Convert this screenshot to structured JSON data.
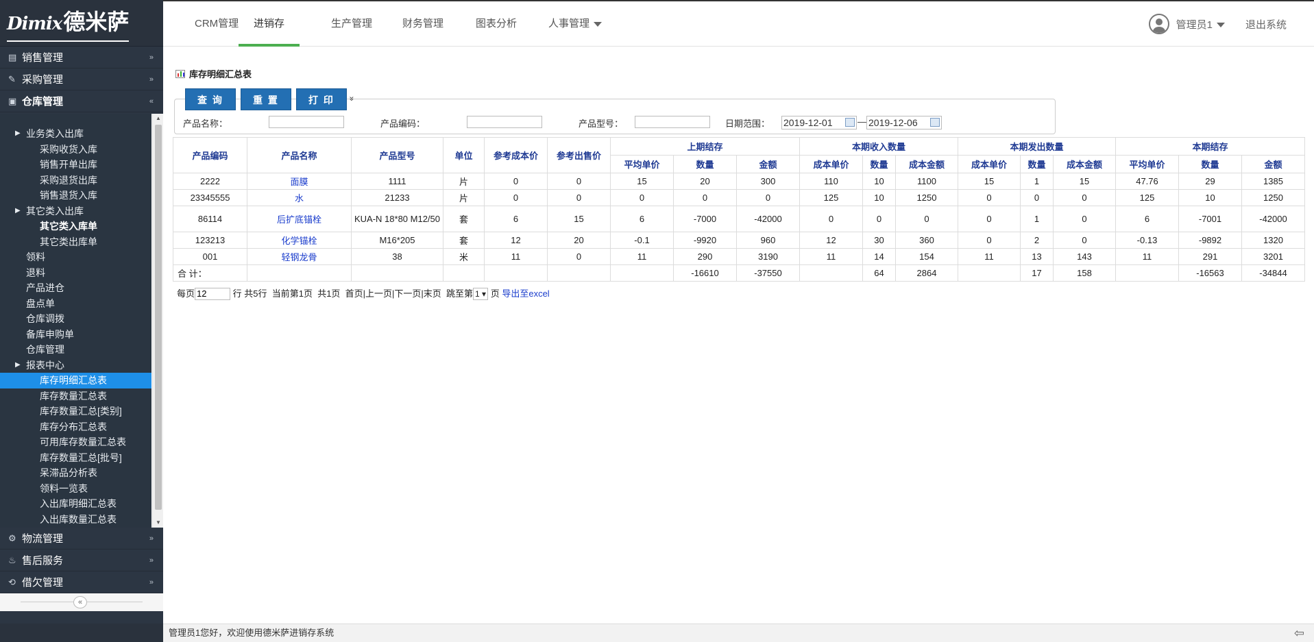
{
  "logo": {
    "en": "Dimix",
    "zh": "德米萨"
  },
  "sidebar": {
    "top_menus": [
      {
        "label": "销售管理",
        "icon": "list-icon",
        "chev": "»"
      },
      {
        "label": "采购管理",
        "icon": "edit-icon",
        "chev": "»"
      },
      {
        "label": "仓库管理",
        "icon": "warehouse-icon",
        "chev": "«"
      }
    ],
    "sub_items": [
      {
        "label": "业务类入出库",
        "level": 1,
        "tri": true
      },
      {
        "label": "采购收货入库",
        "level": 2
      },
      {
        "label": "销售开单出库",
        "level": 2
      },
      {
        "label": "采购退货出库",
        "level": 2
      },
      {
        "label": "销售退货入库",
        "level": 2
      },
      {
        "label": "其它类入出库",
        "level": 1,
        "tri": true
      },
      {
        "label": "其它类入库单",
        "level": 2,
        "bold": true
      },
      {
        "label": "其它类出库单",
        "level": 2
      },
      {
        "label": "领料",
        "level": 1
      },
      {
        "label": "退料",
        "level": 1
      },
      {
        "label": "产品进仓",
        "level": 1
      },
      {
        "label": "盘点单",
        "level": 1
      },
      {
        "label": "仓库调拨",
        "level": 1
      },
      {
        "label": "备库申购单",
        "level": 1
      },
      {
        "label": "仓库管理",
        "level": 1
      },
      {
        "label": "报表中心",
        "level": 1,
        "tri": true
      },
      {
        "label": "库存明细汇总表",
        "level": 2,
        "active": true
      },
      {
        "label": "库存数量汇总表",
        "level": 2
      },
      {
        "label": "库存数量汇总[类别]",
        "level": 2
      },
      {
        "label": "库存分布汇总表",
        "level": 2
      },
      {
        "label": "可用库存数量汇总表",
        "level": 2
      },
      {
        "label": "库存数量汇总[批号]",
        "level": 2
      },
      {
        "label": "呆滞品分析表",
        "level": 2
      },
      {
        "label": "领料一览表",
        "level": 2
      },
      {
        "label": "入出库明细汇总表",
        "level": 2
      },
      {
        "label": "入出库数量汇总表",
        "level": 2
      }
    ],
    "bottom_menus": [
      {
        "label": "物流管理",
        "icon": "logistics-icon",
        "chev": "»"
      },
      {
        "label": "售后服务",
        "icon": "service-icon",
        "chev": "»"
      },
      {
        "label": "借欠管理",
        "icon": "loan-icon",
        "chev": "»"
      }
    ],
    "collapse_glyph": "«"
  },
  "topnav": {
    "items": [
      "CRM管理",
      "进销存",
      "生产管理",
      "财务管理",
      "图表分析",
      "人事管理"
    ],
    "active_index": 1,
    "user": "管理员1",
    "logout": "退出系统"
  },
  "page": {
    "title": "库存明细汇总表",
    "buttons": {
      "query": "查 询",
      "reset": "重 置",
      "print": "打 印"
    },
    "expand_glyph": "»",
    "filters": {
      "product_name_label": "产品名称：",
      "product_code_label": "产品编码：",
      "product_model_label": "产品型号：",
      "date_range_label": "日期范围：",
      "date_from": "2019-12-01",
      "date_sep": "—",
      "date_to": "2019-12-06"
    }
  },
  "table": {
    "group_headers": [
      "上期结存",
      "本期收入数量",
      "本期发出数量",
      "本期结存"
    ],
    "fixed_headers": [
      "产品编码",
      "产品名称",
      "产品型号",
      "单位",
      "参考成本价",
      "参考出售价"
    ],
    "sub_headers": [
      "平均单价",
      "数量",
      "金额",
      "成本单价",
      "数量",
      "成本金额",
      "成本单价",
      "数量",
      "成本金额",
      "平均单价",
      "数量",
      "金额"
    ],
    "rows": [
      [
        "2222",
        "面膜",
        "1111",
        "片",
        "0",
        "0",
        "15",
        "20",
        "300",
        "110",
        "10",
        "1100",
        "15",
        "1",
        "15",
        "47.76",
        "29",
        "1385"
      ],
      [
        "23345555",
        "水",
        "21233",
        "片",
        "0",
        "0",
        "0",
        "0",
        "0",
        "125",
        "10",
        "1250",
        "0",
        "0",
        "0",
        "125",
        "10",
        "1250"
      ],
      [
        "86114",
        "后扩底锚栓",
        "KUA-N 18*80 M12/50",
        "套",
        "6",
        "15",
        "6",
        "-7000",
        "-42000",
        "0",
        "0",
        "0",
        "0",
        "1",
        "0",
        "6",
        "-7001",
        "-42000"
      ],
      [
        "123213",
        "化学锚栓",
        "M16*205",
        "套",
        "12",
        "20",
        "-0.1",
        "-9920",
        "960",
        "12",
        "30",
        "360",
        "0",
        "2",
        "0",
        "-0.13",
        "-9892",
        "1320"
      ],
      [
        "001",
        "轻钢龙骨",
        "38",
        "米",
        "11",
        "0",
        "11",
        "290",
        "3190",
        "11",
        "14",
        "154",
        "11",
        "13",
        "143",
        "11",
        "291",
        "3201"
      ]
    ],
    "total": [
      "合 计：",
      "",
      "",
      "",
      "",
      "",
      "",
      "-16610",
      "-37550",
      "",
      "64",
      "2864",
      "",
      "17",
      "158",
      "",
      "-16563",
      "-34844"
    ]
  },
  "pager": {
    "per_page_label": "每页",
    "per_page_value": "12",
    "rows_text": "行 共5行",
    "current_text": "当前第1页",
    "pages_text": "共1页",
    "nav_text": "首页|上一页|下一页|末页",
    "jump_label": "跳至第",
    "jump_value": "1 ▾",
    "page_suffix": "页",
    "export": "导出至excel"
  },
  "footer": {
    "welcome": "管理员1您好，欢迎使用德米萨进销存系统",
    "back_glyph": "⇦"
  }
}
